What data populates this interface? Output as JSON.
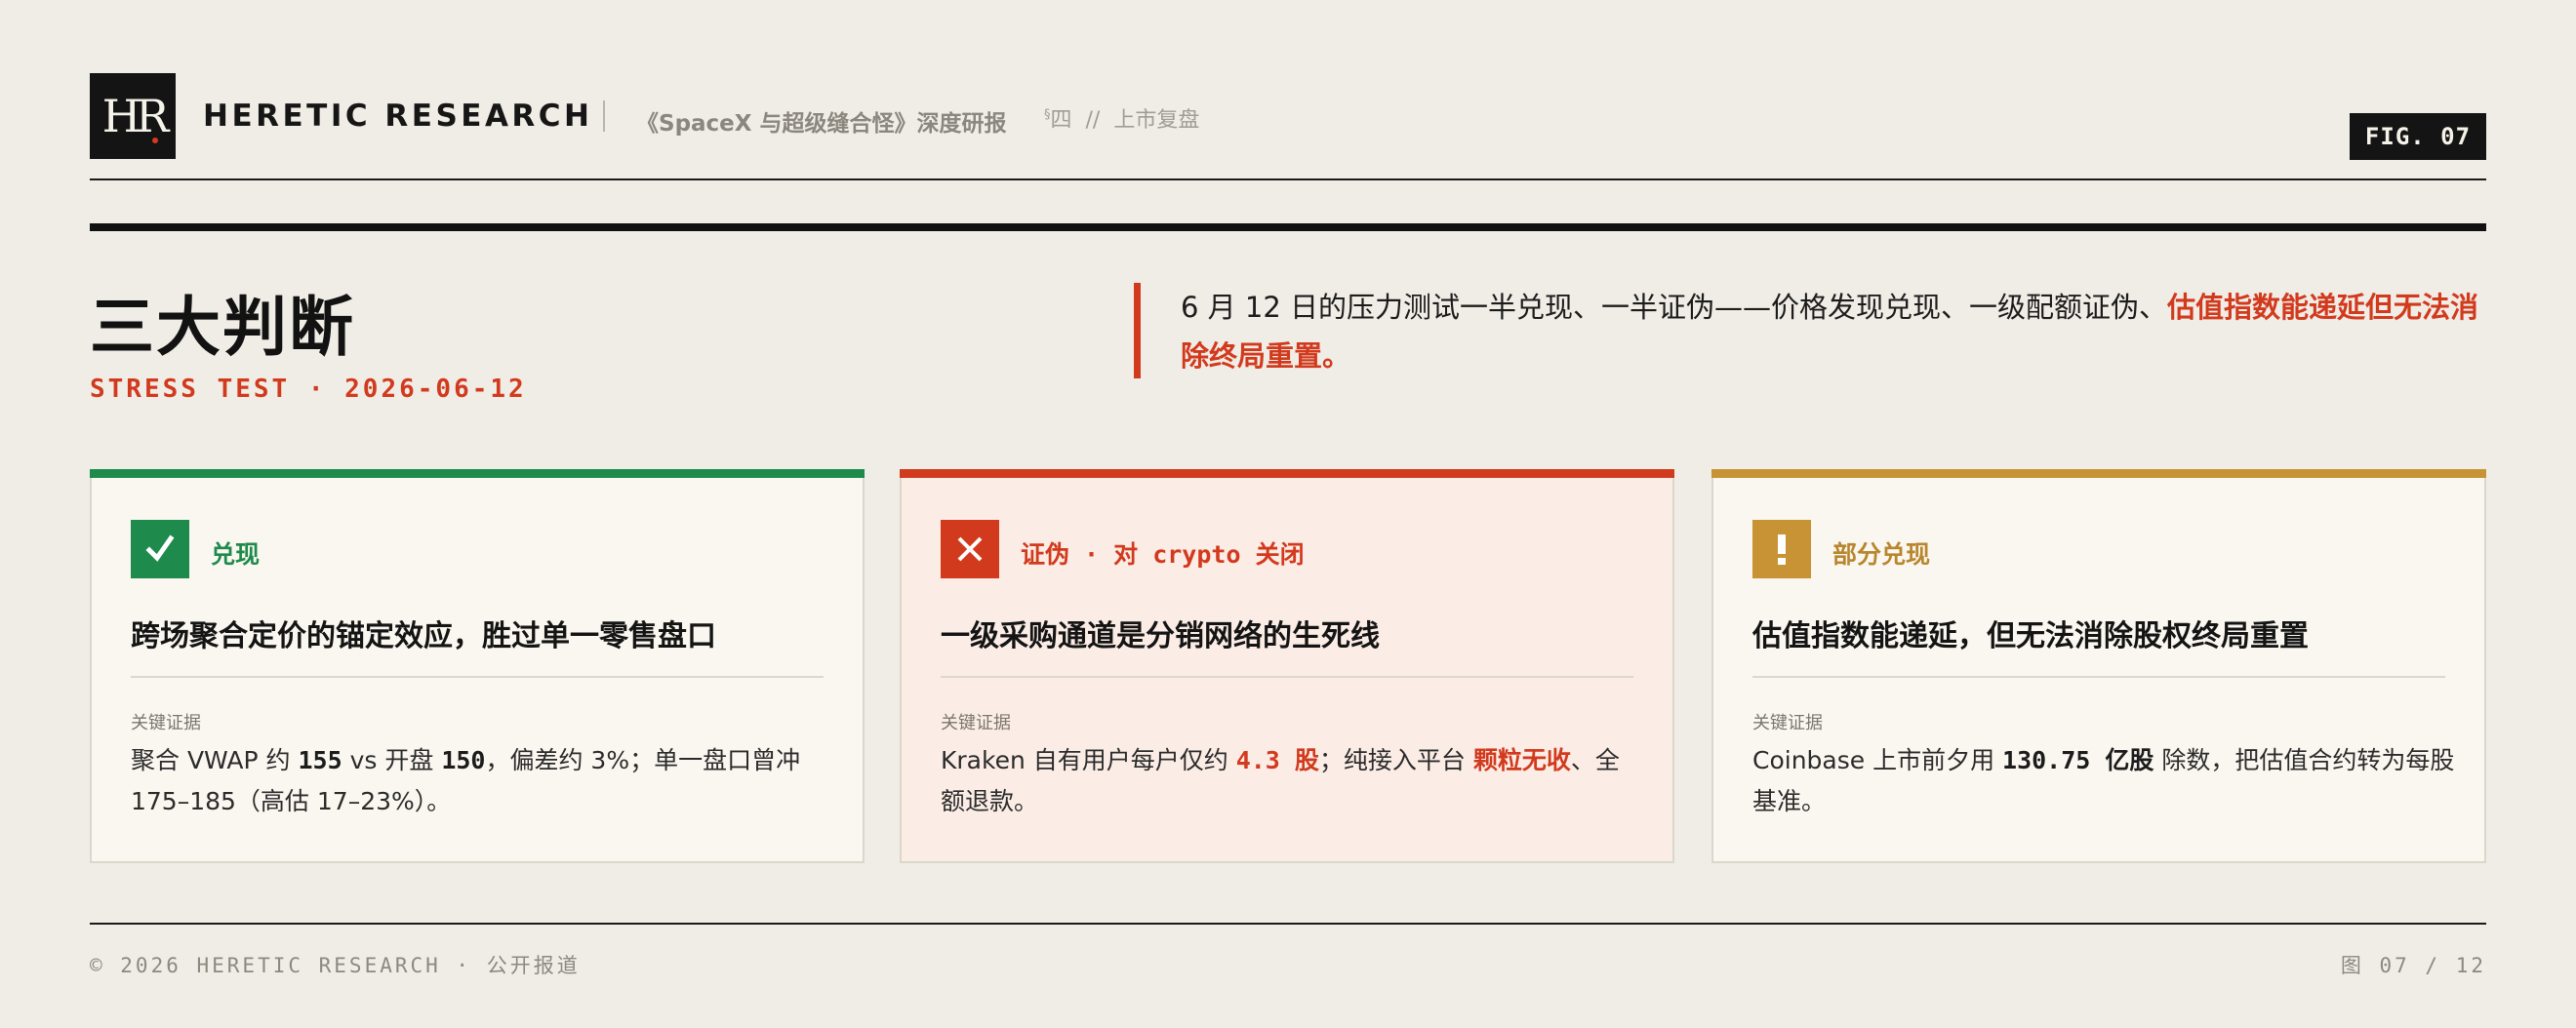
{
  "header": {
    "logo": "HR",
    "brand": "HERETIC RESEARCH",
    "report_title": "《SpaceX 与超级缝合怪》深度研报",
    "section_mark": "§",
    "section_num": "四",
    "section_sep": "//",
    "section_name": "上市复盘",
    "fig_label": "FIG. 07"
  },
  "title": {
    "main": "三大判断",
    "sub": "STRESS TEST · 2026-06-12"
  },
  "quote": {
    "text": "6 月 12 日的压力测试一半兑现、一半证伪——价格发现兑现、一级配额证伪、",
    "highlight": "估值指数能递延但无法消除终局重置。"
  },
  "cards": [
    {
      "verdict": "兑现",
      "icon": "check-icon",
      "heading": "跨场聚合定价的锚定效应，胜过单一零售盘口",
      "evidence_label": "关键证据",
      "evidence": {
        "t1": "聚合 VWAP 约 ",
        "v1": "155",
        "t2": " vs 开盘 ",
        "v2": "150",
        "t3": "，偏差约 3%；单一盘口曾冲 175–185（高估 17–23%）。"
      }
    },
    {
      "verdict": "证伪 · 对 crypto 关闭",
      "icon": "cross-icon",
      "heading": "一级采购通道是分销网络的生死线",
      "evidence_label": "关键证据",
      "evidence": {
        "t1": "Kraken 自有用户每户仅约 ",
        "v1": "4.3 股",
        "t2": "；纯接入平台 ",
        "v2": "颗粒无收",
        "t3": "、全额退款。"
      }
    },
    {
      "verdict": "部分兑现",
      "icon": "exclamation-icon",
      "heading": "估值指数能递延，但无法消除股权终局重置",
      "evidence_label": "关键证据",
      "evidence": {
        "t1": "Coinbase 上市前夕用 ",
        "v1": "130.75 亿股",
        "t2": " 除数，把估值合约转为每股基准。"
      }
    }
  ],
  "footer": {
    "left": "© 2026 HERETIC RESEARCH · 公开报道",
    "right": "图 07 / 12"
  },
  "colors": {
    "accent_red": "#d23a1e",
    "green": "#1e8a4c",
    "gold": "#c79334",
    "ink": "#141414",
    "paper": "#f0ede6"
  }
}
